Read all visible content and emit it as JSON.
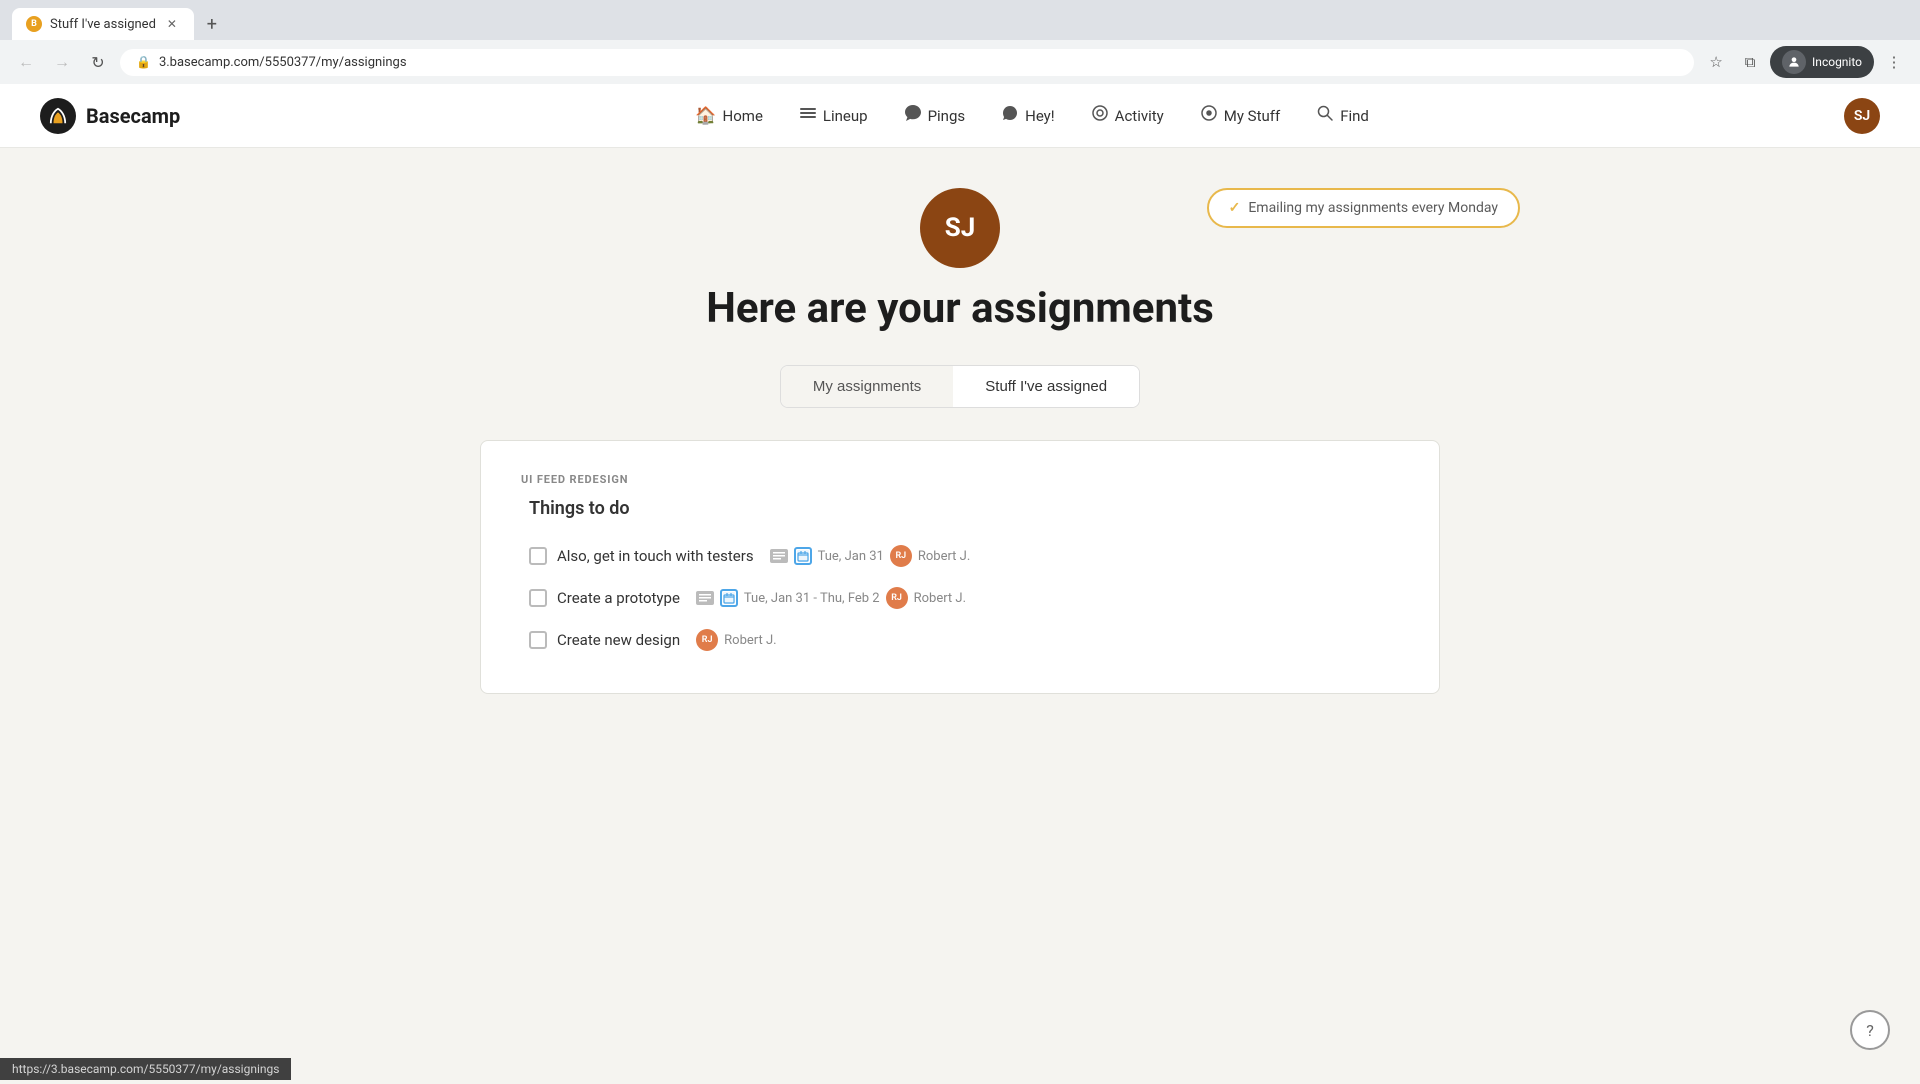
{
  "browser": {
    "tab_title": "Stuff I've assigned",
    "tab_favicon": "B",
    "url": "3.basecamp.com/5550377/my/assignings",
    "incognito_label": "Incognito"
  },
  "nav": {
    "logo_text": "Basecamp",
    "items": [
      {
        "id": "home",
        "label": "Home",
        "icon": "🏠"
      },
      {
        "id": "lineup",
        "label": "Lineup",
        "icon": "≡"
      },
      {
        "id": "pings",
        "label": "Pings",
        "icon": "💬"
      },
      {
        "id": "hey",
        "label": "Hey!",
        "icon": "👋"
      },
      {
        "id": "activity",
        "label": "Activity",
        "icon": "○"
      },
      {
        "id": "mystuff",
        "label": "My Stuff",
        "icon": "⊙"
      },
      {
        "id": "find",
        "label": "Find",
        "icon": "🔍"
      }
    ],
    "user_initials": "SJ"
  },
  "email_badge": {
    "text": "Emailing my assignments every Monday",
    "check": "✓"
  },
  "page": {
    "avatar_initials": "SJ",
    "title": "Here are your assignments"
  },
  "tabs": [
    {
      "id": "my-assignments",
      "label": "My assignments",
      "active": false
    },
    {
      "id": "stuff-ive-assigned",
      "label": "Stuff I've assigned",
      "active": true
    }
  ],
  "section": {
    "label": "UI FEED REDESIGN",
    "group_title": "Things to do",
    "tasks": [
      {
        "id": "task-1",
        "name": "Also, get in touch with testers",
        "has_note": true,
        "has_cal": true,
        "date": "Tue, Jan 31",
        "assignee_initials": "RJ",
        "assignee_name": "Robert J."
      },
      {
        "id": "task-2",
        "name": "Create a prototype",
        "has_note": true,
        "has_cal": true,
        "date": "Tue, Jan 31 - Thu, Feb 2",
        "assignee_initials": "RJ",
        "assignee_name": "Robert J."
      },
      {
        "id": "task-3",
        "name": "Create new design",
        "has_note": false,
        "has_cal": false,
        "date": null,
        "assignee_initials": "RJ",
        "assignee_name": "Robert J."
      }
    ]
  },
  "status_bar": {
    "url": "https://3.basecamp.com/5550377/my/assignings"
  },
  "help_btn": "?"
}
